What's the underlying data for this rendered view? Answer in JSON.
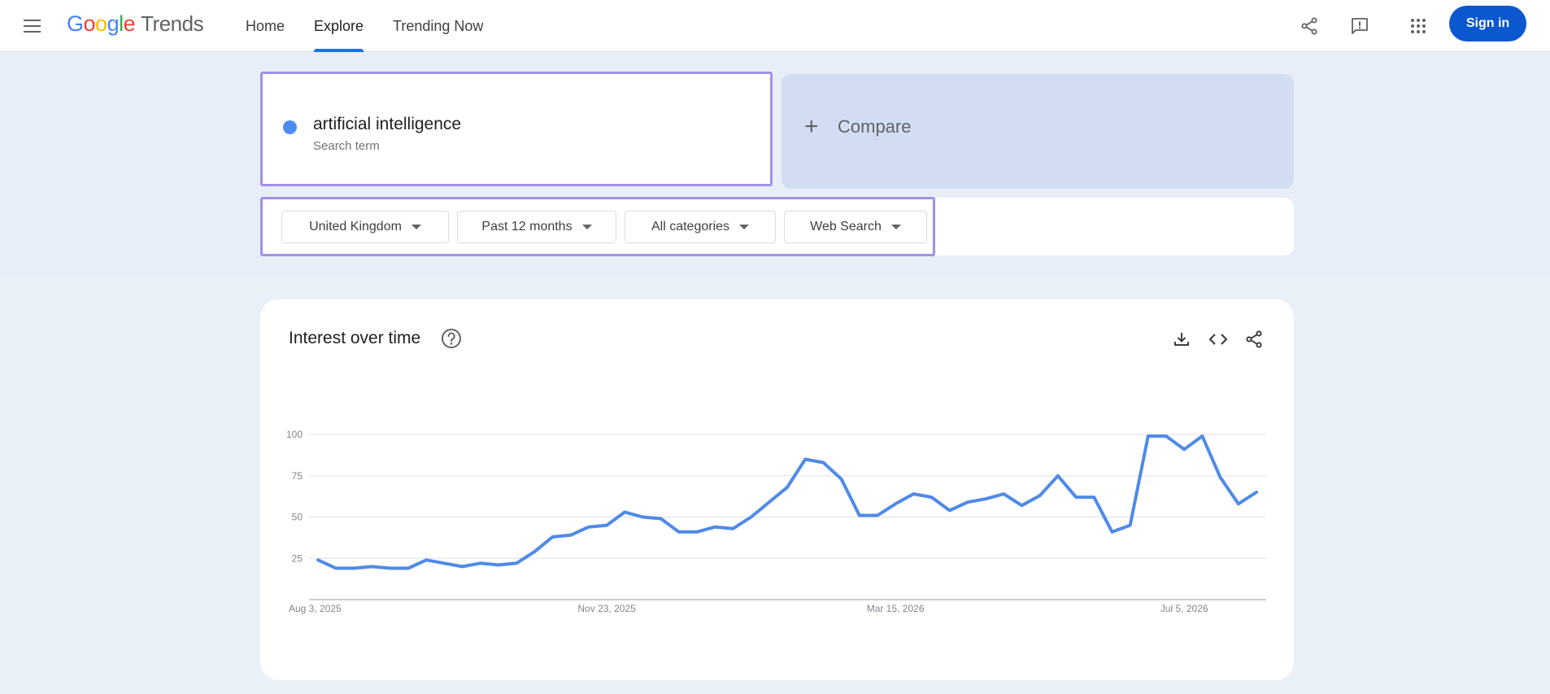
{
  "header": {
    "logo_google": "Google",
    "logo_trends": "Trends",
    "nav": [
      {
        "label": "Home",
        "active": false
      },
      {
        "label": "Explore",
        "active": true
      },
      {
        "label": "Trending Now",
        "active": false
      }
    ],
    "icons": [
      "share-icon",
      "feedback-icon",
      "apps-grid-icon"
    ],
    "sign_in_label": "Sign in"
  },
  "search": {
    "term": "artificial intelligence",
    "term_subtitle": "Search term",
    "term_color": "#4c8bf5",
    "compare_label": "Compare"
  },
  "filters": [
    {
      "label": "United Kingdom"
    },
    {
      "label": "Past 12 months"
    },
    {
      "label": "All categories"
    },
    {
      "label": "Web Search"
    }
  ],
  "chart_card": {
    "title": "Interest over time",
    "icons": [
      "help-icon",
      "download-icon",
      "embed-code-icon",
      "share-icon"
    ]
  },
  "chart_data": {
    "type": "line",
    "title": "Interest over time",
    "xlabel": "",
    "ylabel": "",
    "ylim": [
      0,
      100
    ],
    "y_ticks": [
      25,
      50,
      75,
      100
    ],
    "x_tick_labels": [
      "Aug 3, 2025",
      "Nov 23, 2025",
      "Mar 15, 2026",
      "Jul 5, 2026"
    ],
    "grid": true,
    "legend": "none",
    "series": [
      {
        "color": "#4f8ae8",
        "values": [
          24,
          19,
          19,
          20,
          19,
          19,
          24,
          22,
          20,
          22,
          21,
          22,
          29,
          38,
          39,
          44,
          45,
          53,
          50,
          49,
          41,
          41,
          44,
          43,
          50,
          59,
          68,
          85,
          83,
          73,
          51,
          51,
          58,
          64,
          62,
          54,
          59,
          61,
          64,
          57,
          63,
          75,
          62,
          62,
          41,
          45,
          99,
          99,
          91,
          99,
          74,
          58,
          65
        ]
      }
    ]
  }
}
